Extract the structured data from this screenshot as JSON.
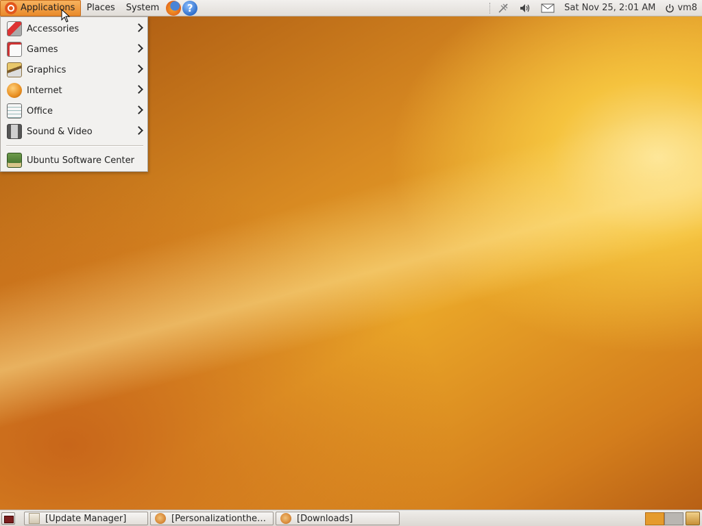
{
  "top_panel": {
    "menus": {
      "applications": "Applications",
      "places": "Places",
      "system": "System"
    },
    "launchers": {
      "firefox_icon": "firefox-icon",
      "help_icon": "help-icon",
      "help_glyph": "?"
    },
    "tray": {
      "network_icon": "network-disconnected-icon",
      "volume_icon": "volume-icon",
      "mail_icon": "mail-icon",
      "clock": "Sat Nov 25,  2:01 AM",
      "user": "vm8"
    }
  },
  "applications_menu": {
    "items": [
      {
        "label": "Accessories",
        "icon": "accessories-icon",
        "submenu": true
      },
      {
        "label": "Games",
        "icon": "games-icon",
        "submenu": true
      },
      {
        "label": "Graphics",
        "icon": "graphics-icon",
        "submenu": true
      },
      {
        "label": "Internet",
        "icon": "internet-icon",
        "submenu": true
      },
      {
        "label": "Office",
        "icon": "office-icon",
        "submenu": true
      },
      {
        "label": "Sound & Video",
        "icon": "sound-video-icon",
        "submenu": true
      },
      {
        "label": "Ubuntu Software Center",
        "icon": "software-center-icon",
        "submenu": false
      }
    ]
  },
  "bottom_panel": {
    "tasks": [
      {
        "label": "[Update Manager]",
        "icon": "update-manager-icon"
      },
      {
        "label": "[Personalizationthemes...]",
        "icon": "firefox-icon"
      },
      {
        "label": "[Downloads]",
        "icon": "firefox-icon"
      }
    ],
    "workspaces": [
      "workspace-1",
      "workspace-2"
    ],
    "trash_icon": "trash-icon"
  },
  "colors": {
    "menu_active": "#e98a2a",
    "panel": "#e6e3df",
    "desktop_accent": "#e9a528"
  }
}
